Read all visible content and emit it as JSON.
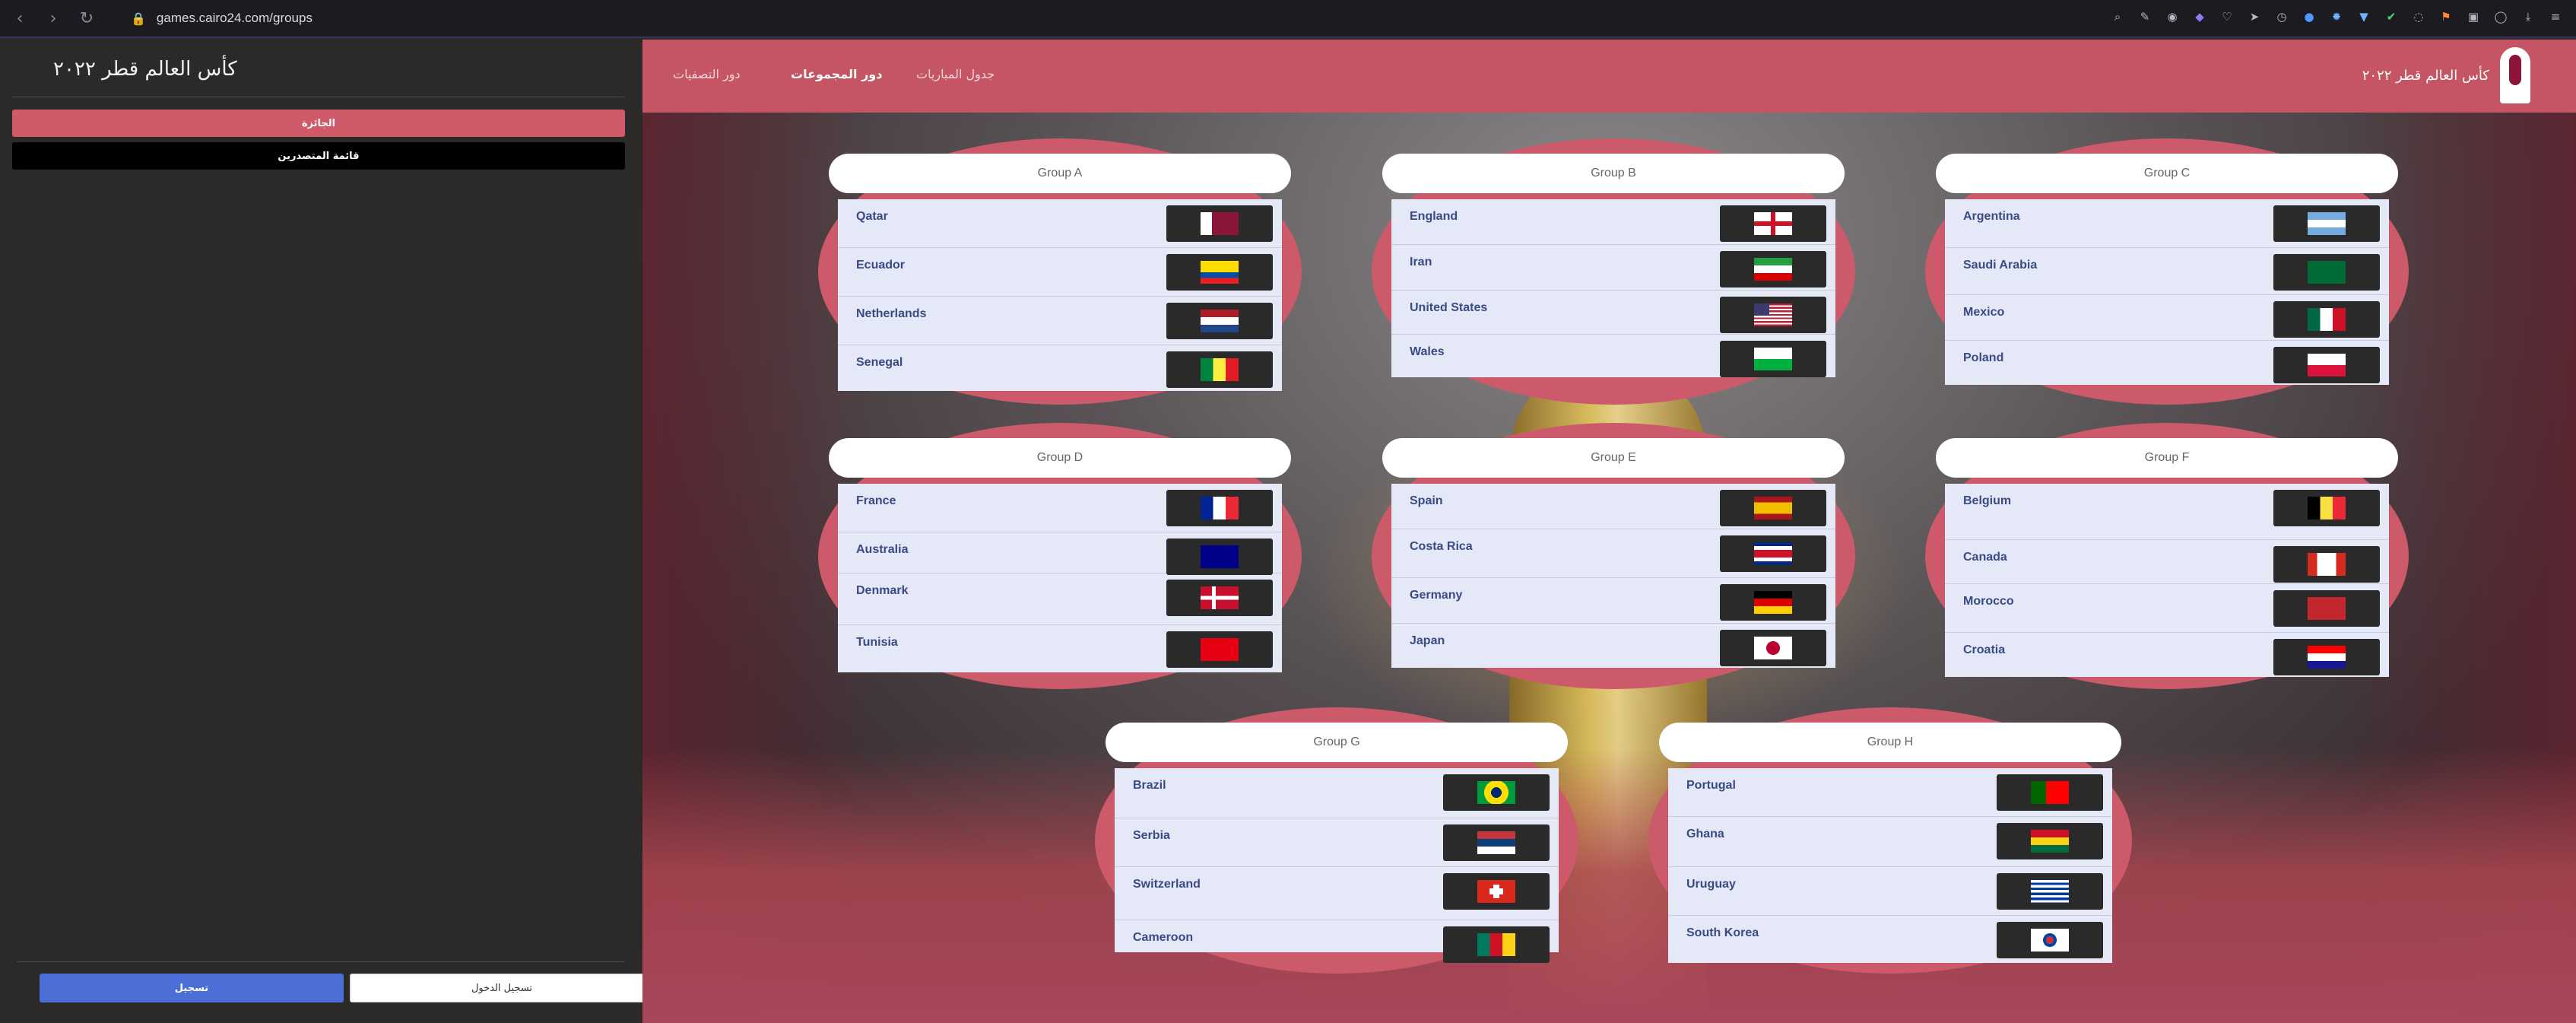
{
  "browser": {
    "url": "games.cairo24.com/groups"
  },
  "sidebar": {
    "title": "كأس العالم قطر ٢٠٢٢",
    "prize_label": "الجائزة",
    "leaders_label": "قائمة المتصدرين",
    "register_label": "تسجيل",
    "login_label": "تسجيل الدخول"
  },
  "topbar": {
    "brand": "كأس العالم قطر ٢٠٢٢",
    "nav": {
      "knockout": "دور التصفيات",
      "groups": "دور المجموعات",
      "schedule": "جدول المباريات"
    }
  },
  "colors": {
    "accent": "#c55465",
    "team_text": "#3a4a86",
    "card_bg": "#e5e8f6"
  },
  "groups": [
    {
      "name": "Group A",
      "teams": [
        "Qatar",
        "Ecuador",
        "Netherlands",
        "Senegal"
      ]
    },
    {
      "name": "Group B",
      "teams": [
        "England",
        "Iran",
        "United States",
        "Wales"
      ]
    },
    {
      "name": "Group C",
      "teams": [
        "Argentina",
        "Saudi Arabia",
        "Mexico",
        "Poland"
      ]
    },
    {
      "name": "Group D",
      "teams": [
        "France",
        "Australia",
        "Denmark",
        "Tunisia"
      ]
    },
    {
      "name": "Group E",
      "teams": [
        "Spain",
        "Costa Rica",
        "Germany",
        "Japan"
      ]
    },
    {
      "name": "Group F",
      "teams": [
        "Belgium",
        "Canada",
        "Morocco",
        "Croatia"
      ]
    },
    {
      "name": "Group G",
      "teams": [
        "Brazil",
        "Serbia",
        "Switzerland",
        "Cameroon"
      ]
    },
    {
      "name": "Group H",
      "teams": [
        "Portugal",
        "Ghana",
        "Uruguay",
        "South Korea"
      ]
    }
  ]
}
